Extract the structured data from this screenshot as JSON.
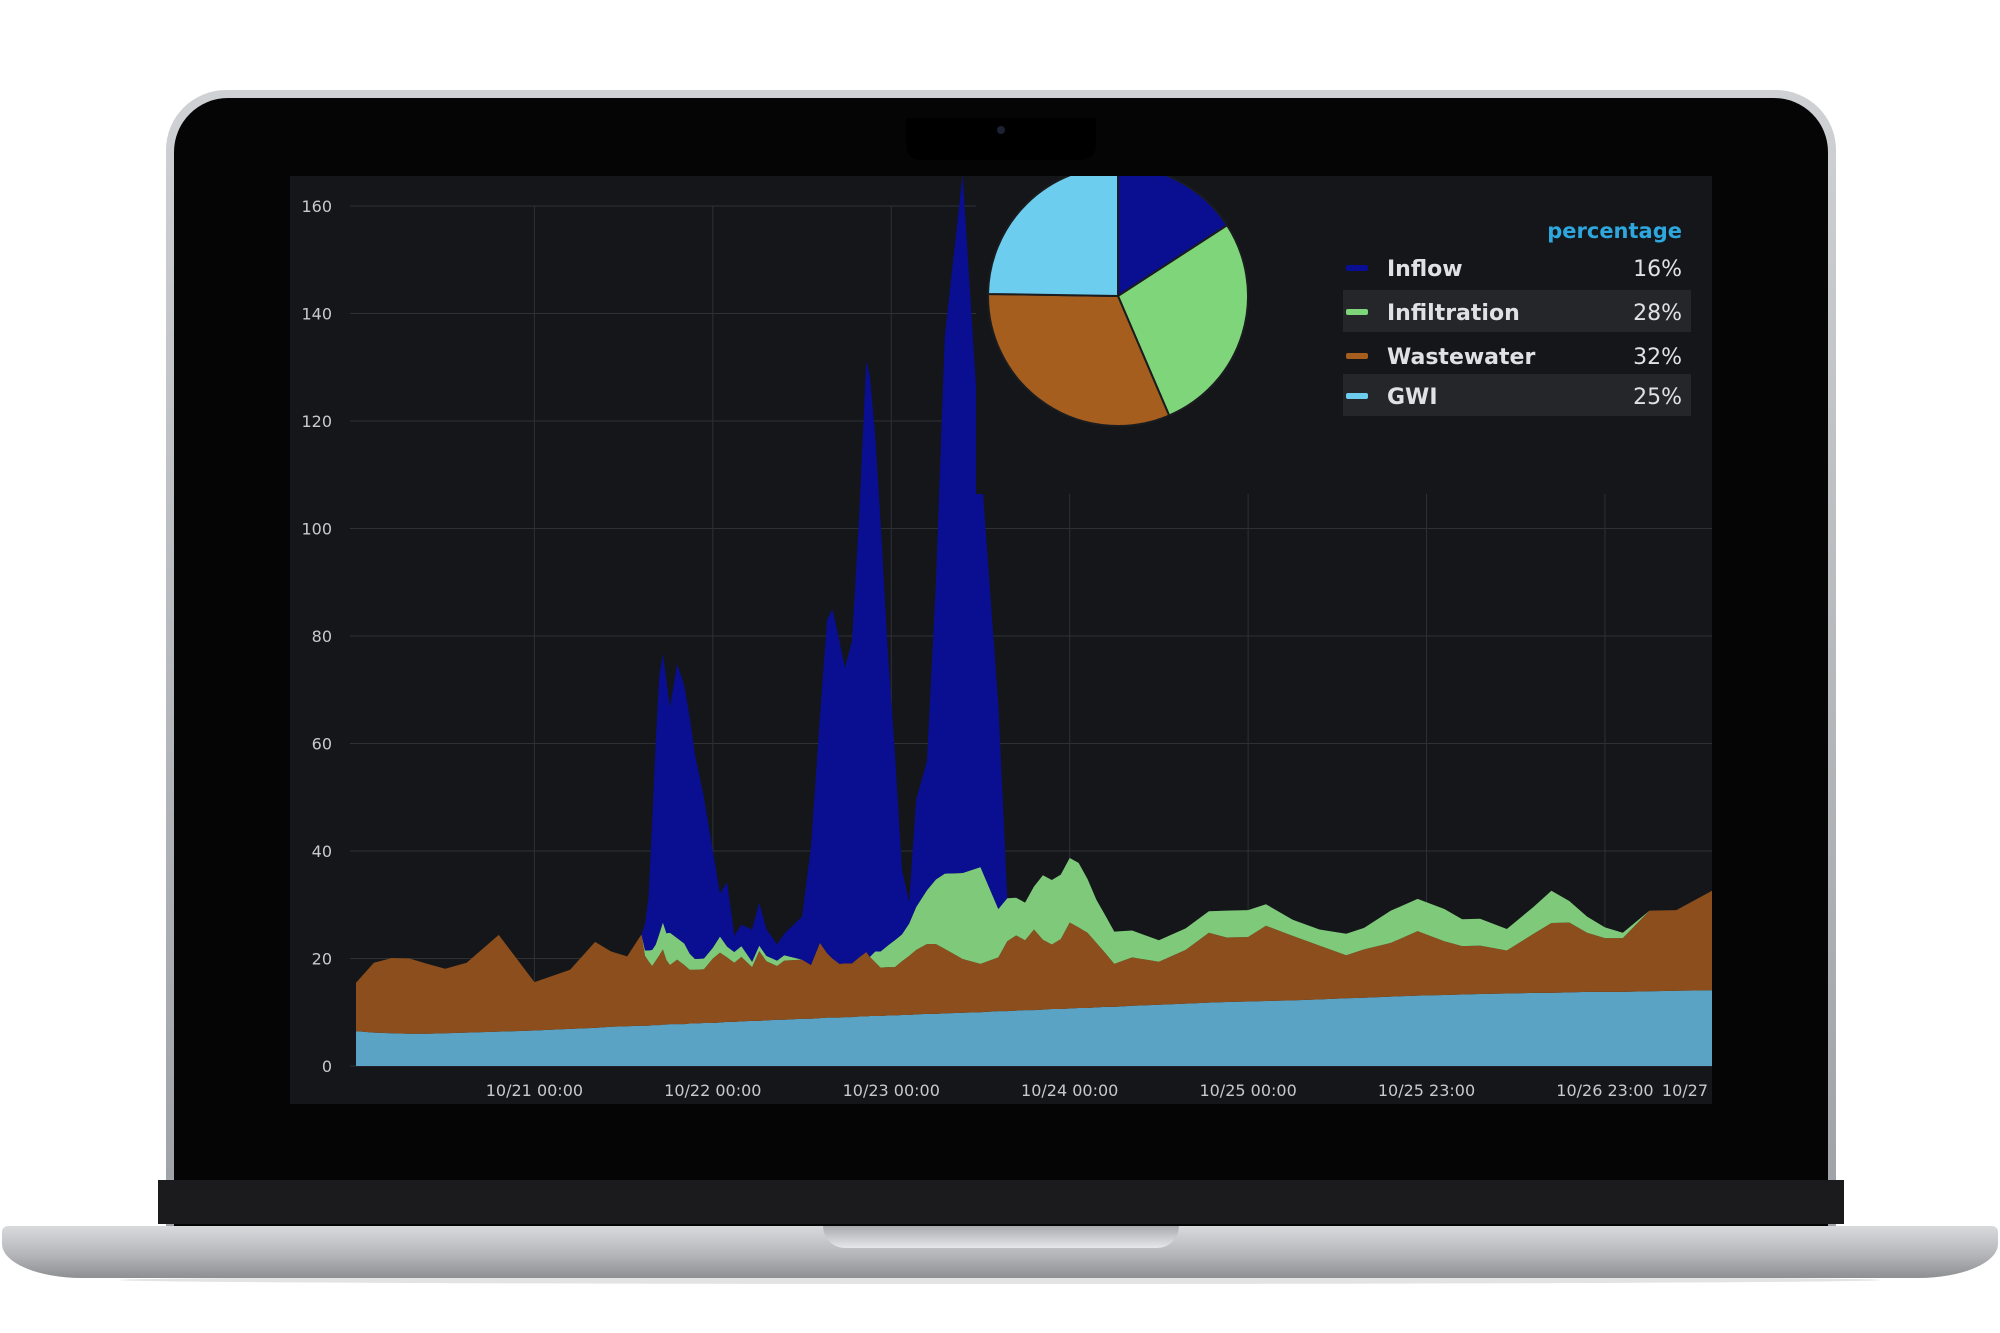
{
  "chart_data": [
    {
      "type": "area",
      "stacked": true,
      "ylim": [
        0,
        160
      ],
      "y_ticks": [
        "0",
        "20",
        "40",
        "60",
        "80",
        "100",
        "120",
        "140",
        "160"
      ],
      "x_tick_labels": [
        "10/21 00:00",
        "10/22 00:00",
        "10/23 00:00",
        "10/24 00:00",
        "10/25 00:00",
        "10/25 23:00",
        "10/26 23:00",
        "10/27"
      ],
      "grid": true,
      "x": [
        0,
        0.1,
        0.2,
        0.3,
        0.4,
        0.5,
        0.62,
        0.8,
        1.0,
        1.2,
        1.34,
        1.43,
        1.52,
        1.6,
        1.62,
        1.64,
        1.66,
        1.68,
        1.7,
        1.72,
        1.74,
        1.76,
        1.8,
        1.84,
        1.87,
        1.9,
        1.95,
        2.0,
        2.04,
        2.08,
        2.12,
        2.16,
        2.22,
        2.26,
        2.3,
        2.36,
        2.4,
        2.5,
        2.55,
        2.6,
        2.64,
        2.67,
        2.71,
        2.74,
        2.78,
        2.82,
        2.86,
        2.88,
        2.91,
        2.94,
        2.98,
        3.02,
        3.06,
        3.1,
        3.14,
        3.2,
        3.25,
        3.3,
        3.4,
        3.5,
        3.6,
        3.65,
        3.7,
        3.75,
        3.8,
        3.85,
        3.9,
        3.95,
        4.0,
        4.05,
        4.1,
        4.15,
        4.2,
        4.25,
        4.35,
        4.5,
        4.65,
        4.78,
        4.88,
        5.0,
        5.1,
        5.25,
        5.4,
        5.55,
        5.65,
        5.8,
        5.95,
        6.1,
        6.2,
        6.3,
        6.45,
        6.6,
        6.7,
        6.8,
        6.9,
        7.0,
        7.1,
        7.25,
        7.4,
        7.6
      ],
      "series": [
        {
          "name": "GWI",
          "color": "#5ba3c4",
          "values": [
            6.5,
            6.2,
            6.1,
            6,
            6,
            6.1,
            6.2,
            6.4,
            6.6,
            6.9,
            7.1,
            7.3,
            7.4,
            7.5,
            7.5,
            7.5,
            7.6,
            7.6,
            7.6,
            7.7,
            7.7,
            7.8,
            7.8,
            7.8,
            7.9,
            7.9,
            8,
            8,
            8.1,
            8.2,
            8.2,
            8.3,
            8.4,
            8.4,
            8.5,
            8.6,
            8.6,
            8.8,
            8.8,
            8.9,
            9,
            9,
            9,
            9.1,
            9.1,
            9.2,
            9.2,
            9.3,
            9.3,
            9.3,
            9.4,
            9.4,
            9.5,
            9.5,
            9.6,
            9.7,
            9.7,
            9.8,
            9.9,
            10,
            10.2,
            10.2,
            10.3,
            10.4,
            10.4,
            10.5,
            10.6,
            10.6,
            10.7,
            10.8,
            10.8,
            10.9,
            11,
            11,
            11.2,
            11.4,
            11.6,
            11.8,
            11.9,
            12,
            12.1,
            12.2,
            12.4,
            12.6,
            12.7,
            12.9,
            13.1,
            13.2,
            13.3,
            13.4,
            13.5,
            13.6,
            13.6,
            13.7,
            13.8,
            13.8,
            13.8,
            13.9,
            14,
            14.1
          ]
        },
        {
          "name": "Wastewater",
          "color": "#8b4e1c",
          "values": [
            9,
            13,
            14,
            14,
            13,
            12,
            13,
            18,
            9,
            11,
            16,
            14,
            13,
            17,
            13,
            12,
            11,
            12,
            13,
            14,
            12,
            11,
            12,
            11,
            10,
            10,
            10,
            12,
            13,
            12,
            11,
            12,
            10,
            13,
            11,
            10,
            11,
            11,
            10,
            14,
            12,
            11,
            10,
            10,
            10,
            11,
            12,
            11,
            10,
            9,
            9,
            9,
            10,
            11,
            12,
            13,
            13,
            12,
            10,
            9,
            10,
            13,
            14,
            13,
            15,
            13,
            12,
            13,
            16,
            15,
            14,
            12,
            10,
            8,
            9,
            8,
            10,
            13,
            12,
            12,
            14,
            12,
            10,
            8,
            9,
            10,
            12,
            10,
            9,
            9,
            8,
            11,
            13,
            13,
            11,
            10,
            10,
            15,
            15,
            18.5
          ]
        },
        {
          "name": "Infiltration",
          "color": "#7fc97a",
          "values": [
            0,
            0,
            0,
            0,
            0,
            0,
            0,
            0,
            0,
            0,
            0,
            0,
            0,
            0,
            1,
            2,
            3,
            3,
            4,
            5,
            5,
            6,
            4,
            4,
            3,
            2,
            2,
            2,
            3,
            2,
            2,
            2,
            1,
            1,
            1,
            1,
            1,
            0,
            0,
            0,
            0,
            0,
            0,
            0,
            0,
            0,
            0,
            0,
            2,
            3,
            4,
            5,
            5,
            6,
            8,
            10,
            12,
            14,
            16,
            18,
            9,
            8,
            7,
            7,
            8,
            12,
            12,
            12,
            12,
            12,
            10,
            8,
            7,
            6,
            5,
            4,
            4,
            4,
            5,
            5,
            4,
            3,
            3,
            4,
            4,
            6,
            6,
            6,
            5,
            5,
            4,
            5,
            6,
            4,
            3,
            2,
            1,
            0,
            0,
            0
          ]
        },
        {
          "name": "Inflow",
          "color": "#0a0f91",
          "values": [
            0,
            0,
            0,
            0,
            0,
            0,
            0,
            0,
            0,
            0,
            0,
            0,
            0,
            0,
            5,
            10,
            24,
            38,
            48,
            50,
            47,
            42,
            51,
            48,
            44,
            38,
            30,
            18,
            8,
            12,
            3,
            4,
            6,
            8,
            5,
            3,
            4,
            8,
            22,
            42,
            62,
            65,
            60,
            55,
            60,
            82,
            110,
            108,
            96,
            80,
            55,
            35,
            12,
            4,
            20,
            24,
            55,
            100,
            130,
            76,
            38,
            0,
            0,
            0,
            0,
            0,
            0,
            0,
            0,
            0,
            0,
            0,
            0,
            0,
            0,
            0,
            0,
            0,
            0,
            0,
            0,
            0,
            0,
            0,
            0,
            0,
            0,
            0,
            0,
            0,
            0,
            0,
            0,
            0,
            0,
            0,
            0,
            0,
            0,
            0
          ]
        }
      ]
    },
    {
      "type": "pie",
      "legend_title": "percentage",
      "categories": [
        "Inflow",
        "Infiltration",
        "Wastewater",
        "GWI"
      ],
      "values": [
        16,
        28,
        32,
        25
      ],
      "labels": [
        "16%",
        "28%",
        "32%",
        "25%"
      ],
      "colors": [
        "#0a0f91",
        "#7fd67a",
        "#a55e1e",
        "#6dcdee"
      ]
    }
  ],
  "theme": {
    "panel_bg": "#141619",
    "grid": "#2d3035",
    "text": "#c7c9cc",
    "legend_title": "#2ea6de",
    "legend_row_bg": "#24262a"
  }
}
